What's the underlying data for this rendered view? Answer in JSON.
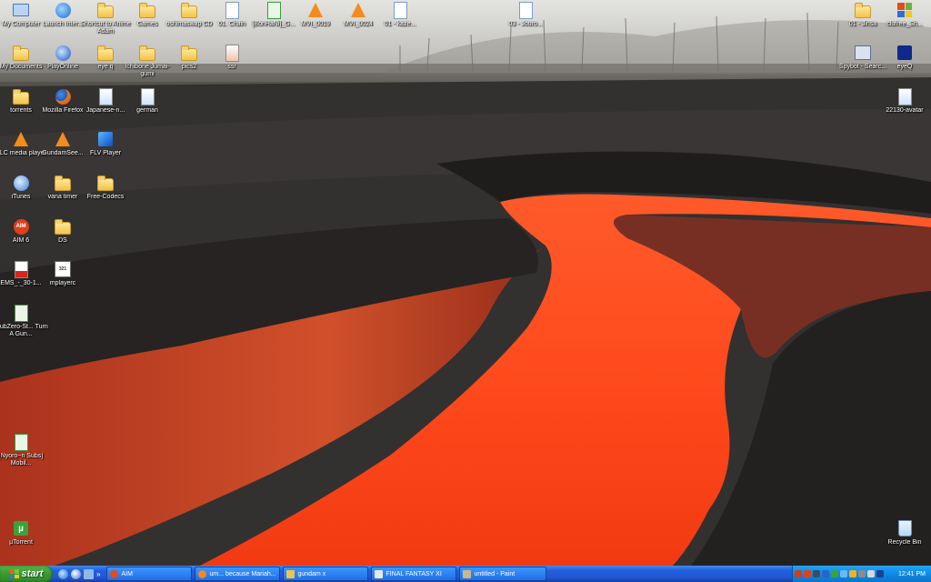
{
  "desktop": {
    "icons": [
      {
        "id": "my-computer",
        "label": "My Computer"
      },
      {
        "id": "launch-internet",
        "label": "Launch Inter..."
      },
      {
        "id": "shortcut-anime-adam",
        "label": "Shortcut to Anime Adam"
      },
      {
        "id": "games",
        "label": "Games"
      },
      {
        "id": "oshimaswap",
        "label": "oshimaswap CD"
      },
      {
        "id": "chain",
        "label": "01. Chain"
      },
      {
        "id": "bonhani",
        "label": "[BonHaNi]_G..."
      },
      {
        "id": "mvi-0019",
        "label": "MVI_0019"
      },
      {
        "id": "mvi-0024",
        "label": "MVI_0024"
      },
      {
        "id": "kaze",
        "label": "01 - kaze..."
      },
      {
        "id": "mp3-top",
        "label": "03 - Jouro..."
      },
      {
        "id": "folder-top-right",
        "label": "01 - Jinsa"
      },
      {
        "id": "cluf-free",
        "label": "clufree_Sh..."
      },
      {
        "id": "my-documents",
        "label": "My Documents"
      },
      {
        "id": "playonline",
        "label": "PlayOnline"
      },
      {
        "id": "eye-q-folder",
        "label": "eye q"
      },
      {
        "id": "jumai-gumi",
        "label": "Ichibone Jumai-gumi"
      },
      {
        "id": "pics2",
        "label": "pics2"
      },
      {
        "id": "ssr",
        "label": "ssr"
      },
      {
        "id": "spybot",
        "label": "Spybot - Searc..."
      },
      {
        "id": "eyeq-app",
        "label": "eyeQ"
      },
      {
        "id": "torrents",
        "label": "torrents"
      },
      {
        "id": "firefox",
        "label": "Mozilla Firefox"
      },
      {
        "id": "japanese",
        "label": "Japanese-n..."
      },
      {
        "id": "german",
        "label": "german"
      },
      {
        "id": "avatar",
        "label": "22130-avatar"
      },
      {
        "id": "vlc",
        "label": "VLC media player"
      },
      {
        "id": "gundamseed",
        "label": "GundamSee..."
      },
      {
        "id": "flv-player",
        "label": "FLV Player"
      },
      {
        "id": "itunes",
        "label": "iTunes"
      },
      {
        "id": "vana-timer",
        "label": "vana timer"
      },
      {
        "id": "free-codecs",
        "label": "Free-Codecs"
      },
      {
        "id": "aim6",
        "label": "AIM 6"
      },
      {
        "id": "ds",
        "label": "DS"
      },
      {
        "id": "ems-pdf",
        "label": "EMS_-_30-1..."
      },
      {
        "id": "mplayerc",
        "label": "mplayerc"
      },
      {
        "id": "subzero",
        "label": "[SubZero-St... Turn A Gun..."
      },
      {
        "id": "nyoro",
        "label": "[Nyoro~n Subs] Mobil..."
      },
      {
        "id": "utorrent",
        "label": "µTorrent"
      },
      {
        "id": "recycle-bin",
        "label": "Recycle Bin"
      }
    ]
  },
  "taskbar": {
    "start_label": "start",
    "tasks": [
      {
        "label": "AIM",
        "color": "#e14b1e"
      },
      {
        "label": "um... because Mariah...",
        "color": "#f08a24"
      },
      {
        "label": "gundam x",
        "color": "#f1c34a"
      },
      {
        "label": "FINAL FANTASY XI",
        "color": "#e8e8e8"
      },
      {
        "label": "untitled - Paint",
        "color": "#c9b88a"
      }
    ],
    "clock": "12:41 PM"
  },
  "colors": {
    "accent": "#245edb",
    "start_green": "#3a9a31",
    "tray": "#0f8be6"
  }
}
